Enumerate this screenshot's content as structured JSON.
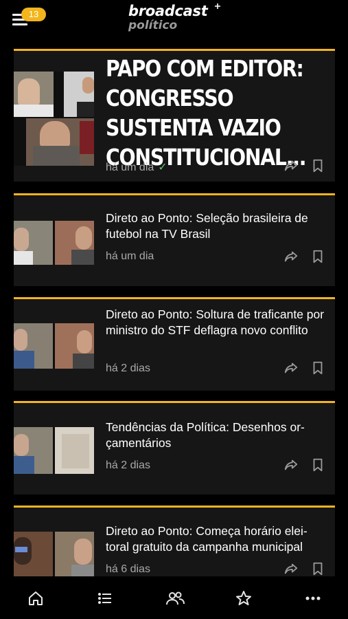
{
  "header": {
    "notification_count": "13",
    "logo_line1": "broadcast",
    "logo_line2": "político",
    "logo_icon": "plus-sparkle-icon"
  },
  "articles": [
    {
      "title": "PAPO COM EDITOR: CONGRESSO SUSTENTA VAZIO CONSTITUCIONAL...",
      "time": "há um dia",
      "read_check": "✓",
      "icons": [
        "share-icon",
        "bookmark-icon"
      ]
    },
    {
      "title": "Direto ao Ponto: Seleção brasileira de futebol na TV Brasil",
      "time": "há um dia",
      "icons": [
        "share-icon",
        "bookmark-icon"
      ]
    },
    {
      "title": "Direto ao Ponto: Soltura de traficante por ministro do STF deflagra novo conflito",
      "time": "há 2 dias",
      "icons": [
        "share-icon",
        "bookmark-icon"
      ]
    },
    {
      "title": "Tendências da Política: Desenhos or-çamentários",
      "time": "há 2 dias",
      "icons": [
        "share-icon",
        "bookmark-icon"
      ]
    },
    {
      "title": "Direto ao Ponto: Começa horário elei-toral gratuito da campanha municipal",
      "time": "há 6 dias",
      "icons": [
        "share-icon",
        "bookmark-icon"
      ]
    }
  ],
  "bottom_nav": {
    "items": [
      "home-icon",
      "list-icon",
      "people-icon",
      "star-icon",
      "more-icon"
    ]
  },
  "colors": {
    "accent": "#f2b420",
    "badge": "#f3b51c",
    "background": "#000000",
    "card": "#161616",
    "muted_text": "#a9a9a9",
    "check": "#5fc46a"
  }
}
